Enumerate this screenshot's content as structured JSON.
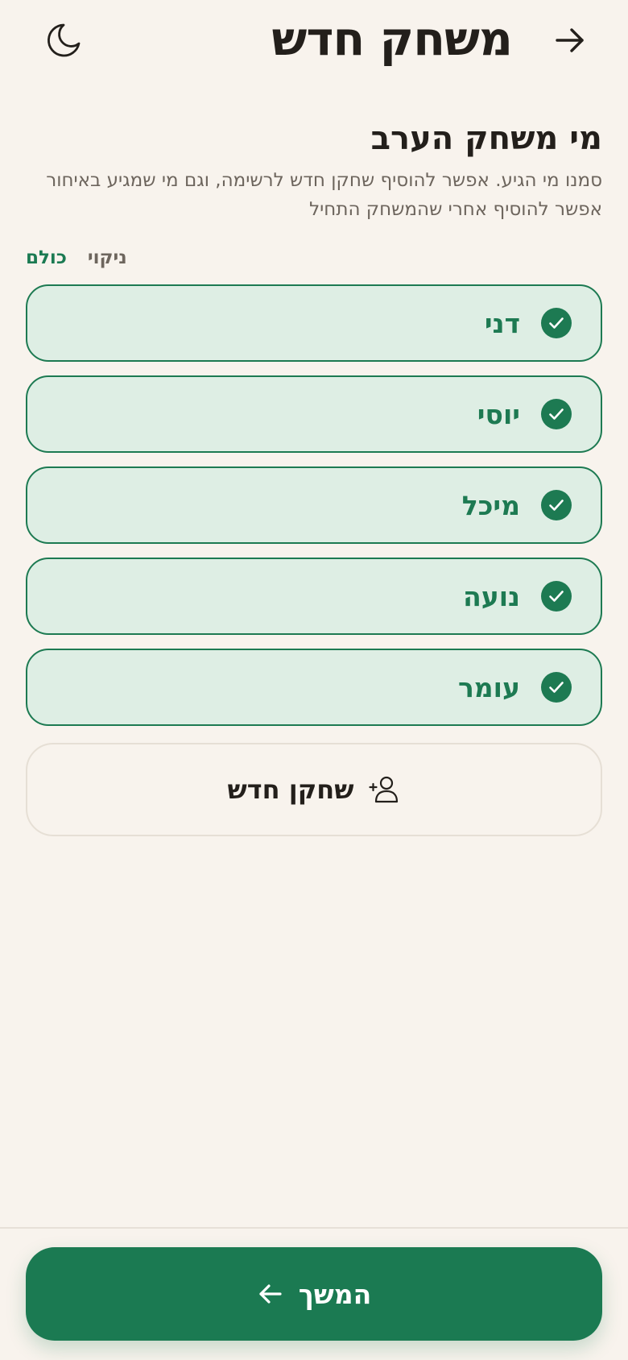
{
  "header": {
    "title": "משחק חדש",
    "back_icon": "arrow-right-icon",
    "theme_icon": "moon-icon"
  },
  "section": {
    "title": "מי משחק הערב",
    "subtitle": "סמנו מי הגיע. אפשר להוסיף שחקן חדש לרשימה, וגם מי שמגיע באיחור אפשר להוסיף אחרי שהמשחק התחיל"
  },
  "quick_actions": {
    "select_all": "כולם",
    "clear": "ניקוי"
  },
  "players": [
    {
      "name": "דני",
      "selected": true
    },
    {
      "name": "יוסי",
      "selected": true
    },
    {
      "name": "מיכל",
      "selected": true
    },
    {
      "name": "נועה",
      "selected": true
    },
    {
      "name": "עומר",
      "selected": true
    }
  ],
  "add_player": {
    "label": "שחקן חדש",
    "icon": "add-user-icon"
  },
  "footer": {
    "continue_label": "המשך",
    "continue_icon": "arrow-left-icon"
  },
  "colors": {
    "background": "#f8f3ed",
    "accent": "#1b7a52",
    "selected_bg": "#deeee4",
    "text": "#231f1b",
    "muted": "#6d655d"
  }
}
